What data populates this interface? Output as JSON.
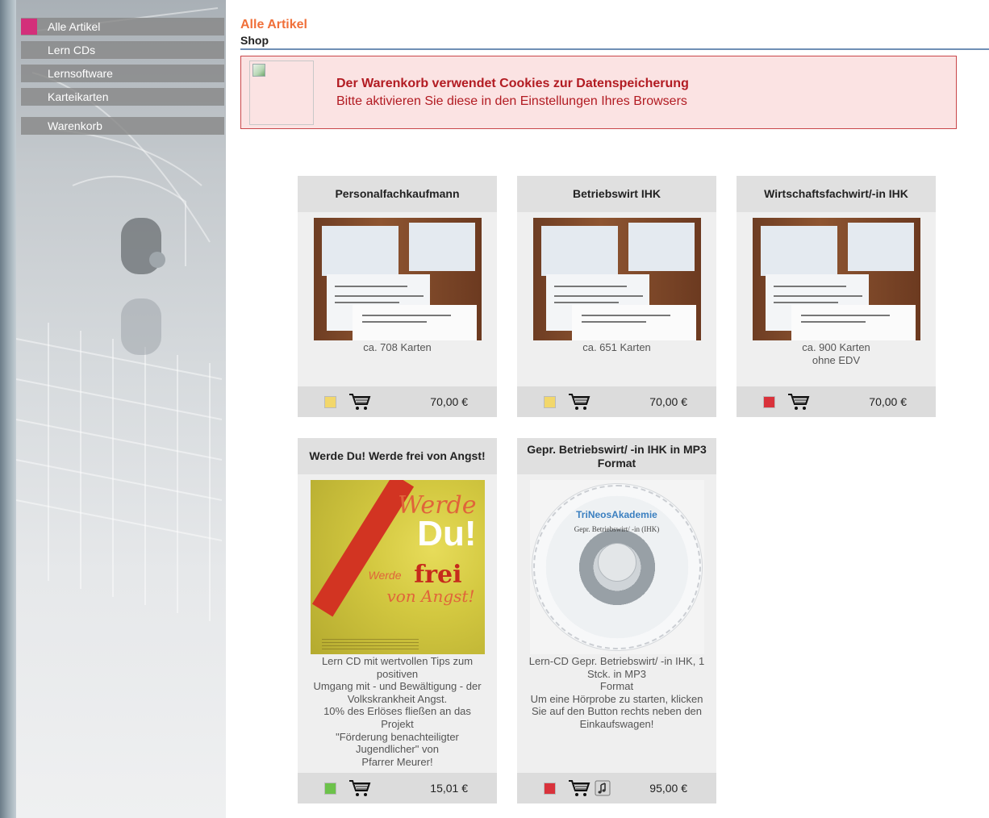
{
  "nav": {
    "items": [
      {
        "label": "Alle Artikel",
        "active": true
      },
      {
        "label": "Lern CDs",
        "active": false
      },
      {
        "label": "Lernsoftware",
        "active": false
      },
      {
        "label": "Karteikarten",
        "active": false
      },
      {
        "label": "Warenkorb",
        "active": false
      }
    ],
    "active_color": "#d32f7a"
  },
  "header": {
    "title": "Alle Artikel",
    "subtitle": "Shop"
  },
  "cookie_notice": {
    "title": "Der Warenkorb verwendet Cookies zur Datenspeicherung",
    "text": "Bitte aktivieren Sie diese in den Einstellungen Ihres Browsers"
  },
  "products": [
    {
      "name": "Personalfachkaufmann",
      "description": "ca. 708 Karten",
      "price": "70,00 €",
      "status_color": "#f2d76b",
      "image": "karteikarten-photo",
      "audio": false
    },
    {
      "name": "Betriebswirt IHK",
      "description": "ca. 651 Karten",
      "price": "70,00 €",
      "status_color": "#f2d76b",
      "image": "karteikarten-photo",
      "audio": false
    },
    {
      "name": "Wirtschaftsfachwirt/-in IHK",
      "description": "ca. 900 Karten\nohne EDV",
      "price": "70,00 €",
      "status_color": "#d9323b",
      "image": "karteikarten-photo",
      "audio": false
    },
    {
      "name": "Werde Du! Werde frei von Angst!",
      "description": "Lern CD mit wertvollen Tips zum\npositiven\nUmgang mit - und Bewältigung - der\nVolkskrankheit Angst.\n10% des Erlöses fließen an das\nProjekt\n\"Förderung benachteiligter\nJugendlicher\" von\nPfarrer Meurer!",
      "price": "15,01 €",
      "status_color": "#6cc24a",
      "image": "angst-cover",
      "audio": false,
      "cover": {
        "t1": "Werde",
        "t2": "Du!",
        "t3": "Werde",
        "t4": "frei",
        "t5": "von Angst!"
      }
    },
    {
      "name": "Gepr. Betriebswirt/ -in IHK in MP3 Format",
      "description": "Lern-CD Gepr. Betriebswirt/ -in IHK, 1\nStck. in MP3\nFormat\nUm eine Hörprobe zu starten, klicken\nSie auf den Button rechts neben den\nEinkaufswagen!",
      "price": "95,00 €",
      "status_color": "#d9323b",
      "image": "cd",
      "audio": true,
      "cd": {
        "brand": "TriNeosAkademie",
        "sub": "Gepr. Betriebswirt/ -in (IHK)"
      }
    }
  ]
}
